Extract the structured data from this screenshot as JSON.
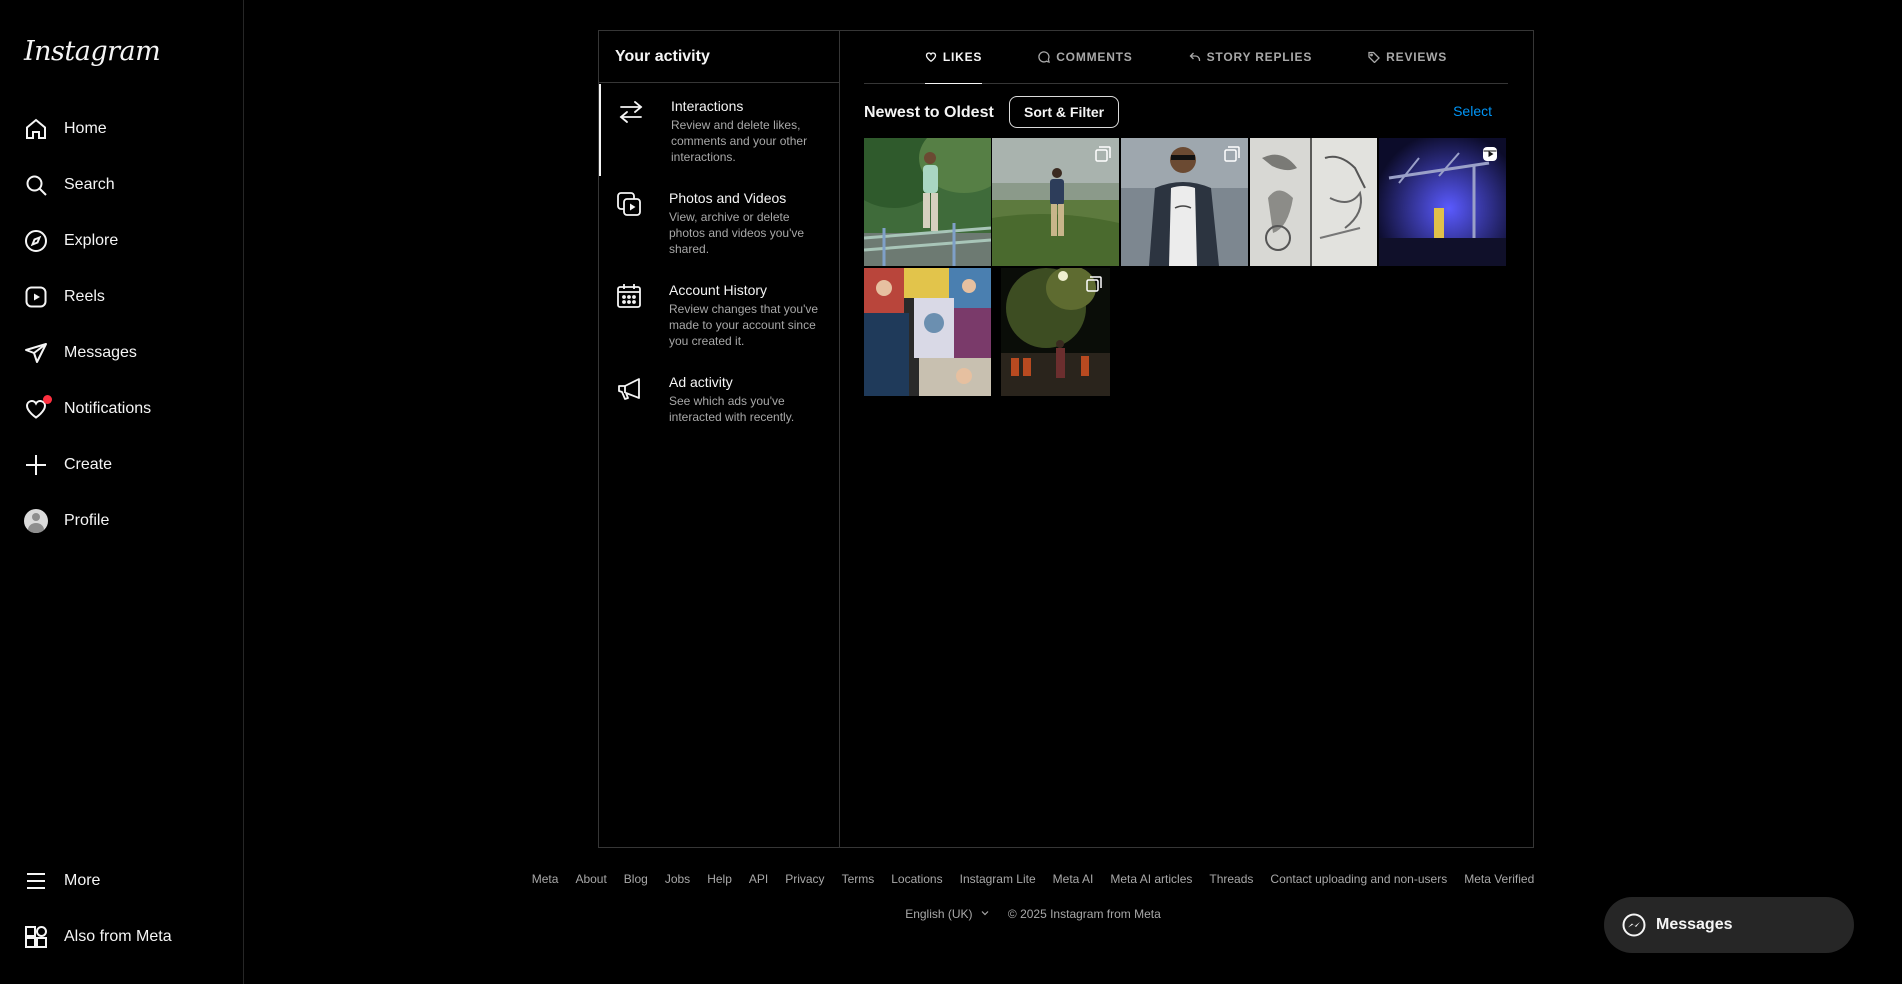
{
  "brand": {
    "logo_text": "Instagram"
  },
  "sidebar": {
    "items": [
      {
        "label": "Home",
        "icon": "home-icon"
      },
      {
        "label": "Search",
        "icon": "search-icon"
      },
      {
        "label": "Explore",
        "icon": "compass-icon"
      },
      {
        "label": "Reels",
        "icon": "reels-icon"
      },
      {
        "label": "Messages",
        "icon": "send-icon"
      },
      {
        "label": "Notifications",
        "icon": "heart-icon",
        "has_dot": true
      },
      {
        "label": "Create",
        "icon": "plus-icon"
      },
      {
        "label": "Profile",
        "icon": "avatar-icon"
      }
    ],
    "bottom": [
      {
        "label": "More",
        "icon": "menu-icon"
      },
      {
        "label": "Also from Meta",
        "icon": "meta-apps-icon"
      }
    ]
  },
  "activity": {
    "title": "Your activity",
    "items": [
      {
        "title": "Interactions",
        "desc": "Review and delete likes, comments and your other interactions.",
        "icon": "interactions-icon",
        "active": true
      },
      {
        "title": "Photos and Videos",
        "desc": "View, archive or delete photos and videos you've shared.",
        "icon": "photos-videos-icon"
      },
      {
        "title": "Account History",
        "desc": "Review changes that you've made to your account since you created it.",
        "icon": "calendar-icon"
      },
      {
        "title": "Ad activity",
        "desc": "See which ads you've interacted with recently.",
        "icon": "megaphone-icon"
      }
    ]
  },
  "tabs": [
    {
      "label": "LIKES",
      "icon": "heart-icon",
      "active": true
    },
    {
      "label": "COMMENTS",
      "icon": "comment-icon"
    },
    {
      "label": "STORY REPLIES",
      "icon": "reply-icon"
    },
    {
      "label": "REVIEWS",
      "icon": "tag-icon"
    }
  ],
  "sort": {
    "order_label": "Newest to Oldest",
    "filter_button": "Sort & Filter",
    "select_label": "Select"
  },
  "posts": [
    {
      "scene": "man in green shirt on riverside railing with trees",
      "badge": null,
      "colors": [
        "#3f6b3a",
        "#6f8f5e",
        "#a8c5b8"
      ]
    },
    {
      "scene": "man standing on grassy field under cloudy sky",
      "badge": "carousel",
      "colors": [
        "#9aa6a0",
        "#6b7f55",
        "#3e5a2c"
      ]
    },
    {
      "scene": "man in white tee and checked shirt by water",
      "badge": "carousel",
      "colors": [
        "#7d8790",
        "#2c3440",
        "#e6e6e6"
      ]
    },
    {
      "scene": "pencil sketches of birds and faces",
      "badge": null,
      "colors": [
        "#d8d8d4",
        "#9c9c98",
        "#4a4a48"
      ]
    },
    {
      "scene": "concert stage with purple lights",
      "badge": "reel",
      "colors": [
        "#1a1a6e",
        "#3b3bc9",
        "#0c0c2a"
      ]
    },
    {
      "scene": "colorful collage of portraits and posters",
      "badge": null,
      "colors": [
        "#b9453b",
        "#e2c44b",
        "#4a7fb0"
      ]
    },
    {
      "scene": "trees and people at night under street light",
      "badge": "carousel",
      "colors": [
        "#1d2a14",
        "#4d5b2a",
        "#0a0d08"
      ]
    }
  ],
  "footer": {
    "links": [
      "Meta",
      "About",
      "Blog",
      "Jobs",
      "Help",
      "API",
      "Privacy",
      "Terms",
      "Locations",
      "Instagram Lite",
      "Meta AI",
      "Meta AI articles",
      "Threads",
      "Contact uploading and non-users",
      "Meta Verified"
    ],
    "language": "English (UK)",
    "copyright": "© 2025 Instagram from Meta"
  },
  "floating_messages": {
    "label": "Messages",
    "icon": "messenger-icon"
  }
}
